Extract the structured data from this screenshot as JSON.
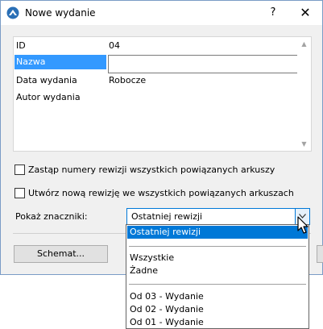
{
  "window": {
    "title": "Nowe wydanie",
    "help_label": "?",
    "close_label": "✕"
  },
  "properties": [
    {
      "label": "ID",
      "value": "04"
    },
    {
      "label": "Nazwa",
      "value": ""
    },
    {
      "label": "Data wydania",
      "value": "Robocze"
    },
    {
      "label": "Autor wydania",
      "value": ""
    }
  ],
  "checkboxes": [
    {
      "label": "Zastąp numery rewizji wszystkich powiązanych arkuszy",
      "checked": false
    },
    {
      "label": "Utwórz nową rewizję we wszystkich powiązanych arkuszach",
      "checked": false
    }
  ],
  "markers": {
    "label": "Pokaż znaczniki:",
    "selected": "Ostatniej rewizji",
    "options": [
      {
        "label": "Ostatniej rewizji"
      },
      {
        "label": "Wszystkie"
      },
      {
        "label": "Żadne"
      },
      {
        "label": "Od 03 - Wydanie"
      },
      {
        "label": "Od 02 - Wydanie"
      },
      {
        "label": "Od 01 - Wydanie"
      }
    ]
  },
  "buttons": {
    "schemat": "Schemat..."
  },
  "icons": {
    "app": "archicad-icon",
    "dropdown": "chevron-down-icon",
    "scroll_up": "scroll-up-arrow-icon",
    "scroll_down": "scroll-down-arrow-icon",
    "cursor": "mouse-pointer-icon"
  },
  "colors": {
    "selection": "#3399ff",
    "list_selection": "#0078d7",
    "focus_border": "#0078d7"
  }
}
